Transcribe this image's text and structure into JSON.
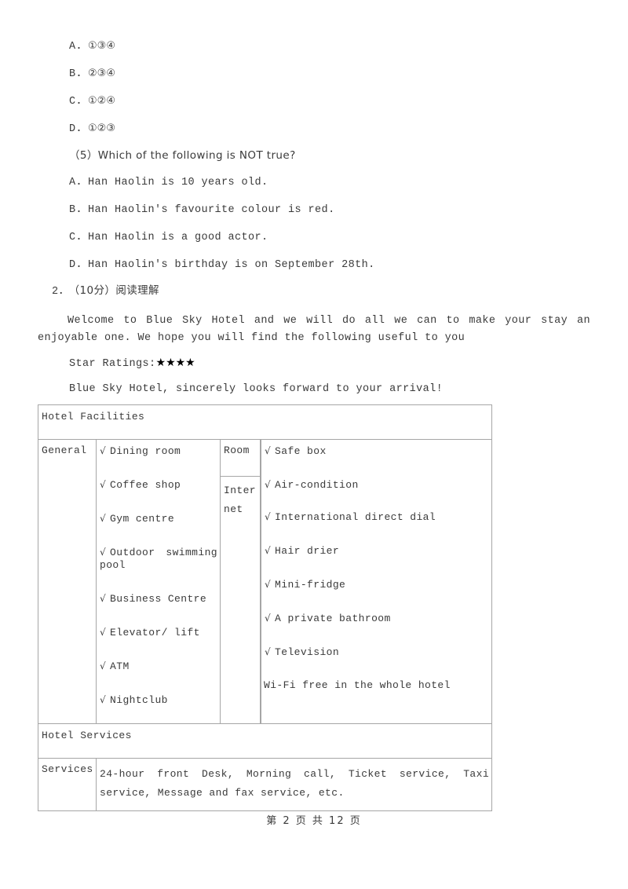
{
  "document": {
    "options_prev_question": [
      {
        "label": "A．",
        "text": "①③④"
      },
      {
        "label": "B．",
        "text": "②③④"
      },
      {
        "label": "C．",
        "text": "①②④"
      },
      {
        "label": "D．",
        "text": "①②③"
      }
    ],
    "question_5": {
      "stem": "（5）Which of the following is NOT true?",
      "options": [
        {
          "label": "A．",
          "text": "Han Haolin is 10 years old."
        },
        {
          "label": "B．",
          "text": "Han Haolin's favourite colour is red."
        },
        {
          "label": "C．",
          "text": "Han Haolin is a good actor."
        },
        {
          "label": "D．",
          "text": "Han Haolin's birthday is on September 28th."
        }
      ]
    },
    "question_2": {
      "number": "2．",
      "points": "（10分）阅读理解",
      "passage": "Welcome to Blue Sky Hotel and we will do all we can to make your stay an enjoyable one. We hope you will find the following useful to you",
      "star_label": "Star Ratings:",
      "stars": "★★★★",
      "closing": "Blue Sky Hotel, sincerely looks forward to your arrival!"
    },
    "table": {
      "facilities_header": "Hotel Facilities",
      "general_label": "General",
      "general_items": [
        "Dining room",
        "Coffee shop",
        "Gym centre",
        "Outdoor swimming pool",
        "Business Centre",
        "Elevator/ lift",
        "ATM",
        "Nightclub"
      ],
      "room_label": "Room",
      "internet_label": "Internet",
      "room_items": [
        "Safe box",
        "Air-condition",
        "International direct dial",
        "Hair drier",
        "Mini-fridge",
        "A private bathroom",
        "Television"
      ],
      "wifi_note": "Wi-Fi free in the whole hotel",
      "services_header": "Hotel Services",
      "services_label": "Services",
      "services_text": "24-hour front Desk, Morning call, Ticket service, Taxi service, Message and fax service, etc.",
      "tick": "√"
    },
    "footer": "第 2 页 共 12 页"
  }
}
